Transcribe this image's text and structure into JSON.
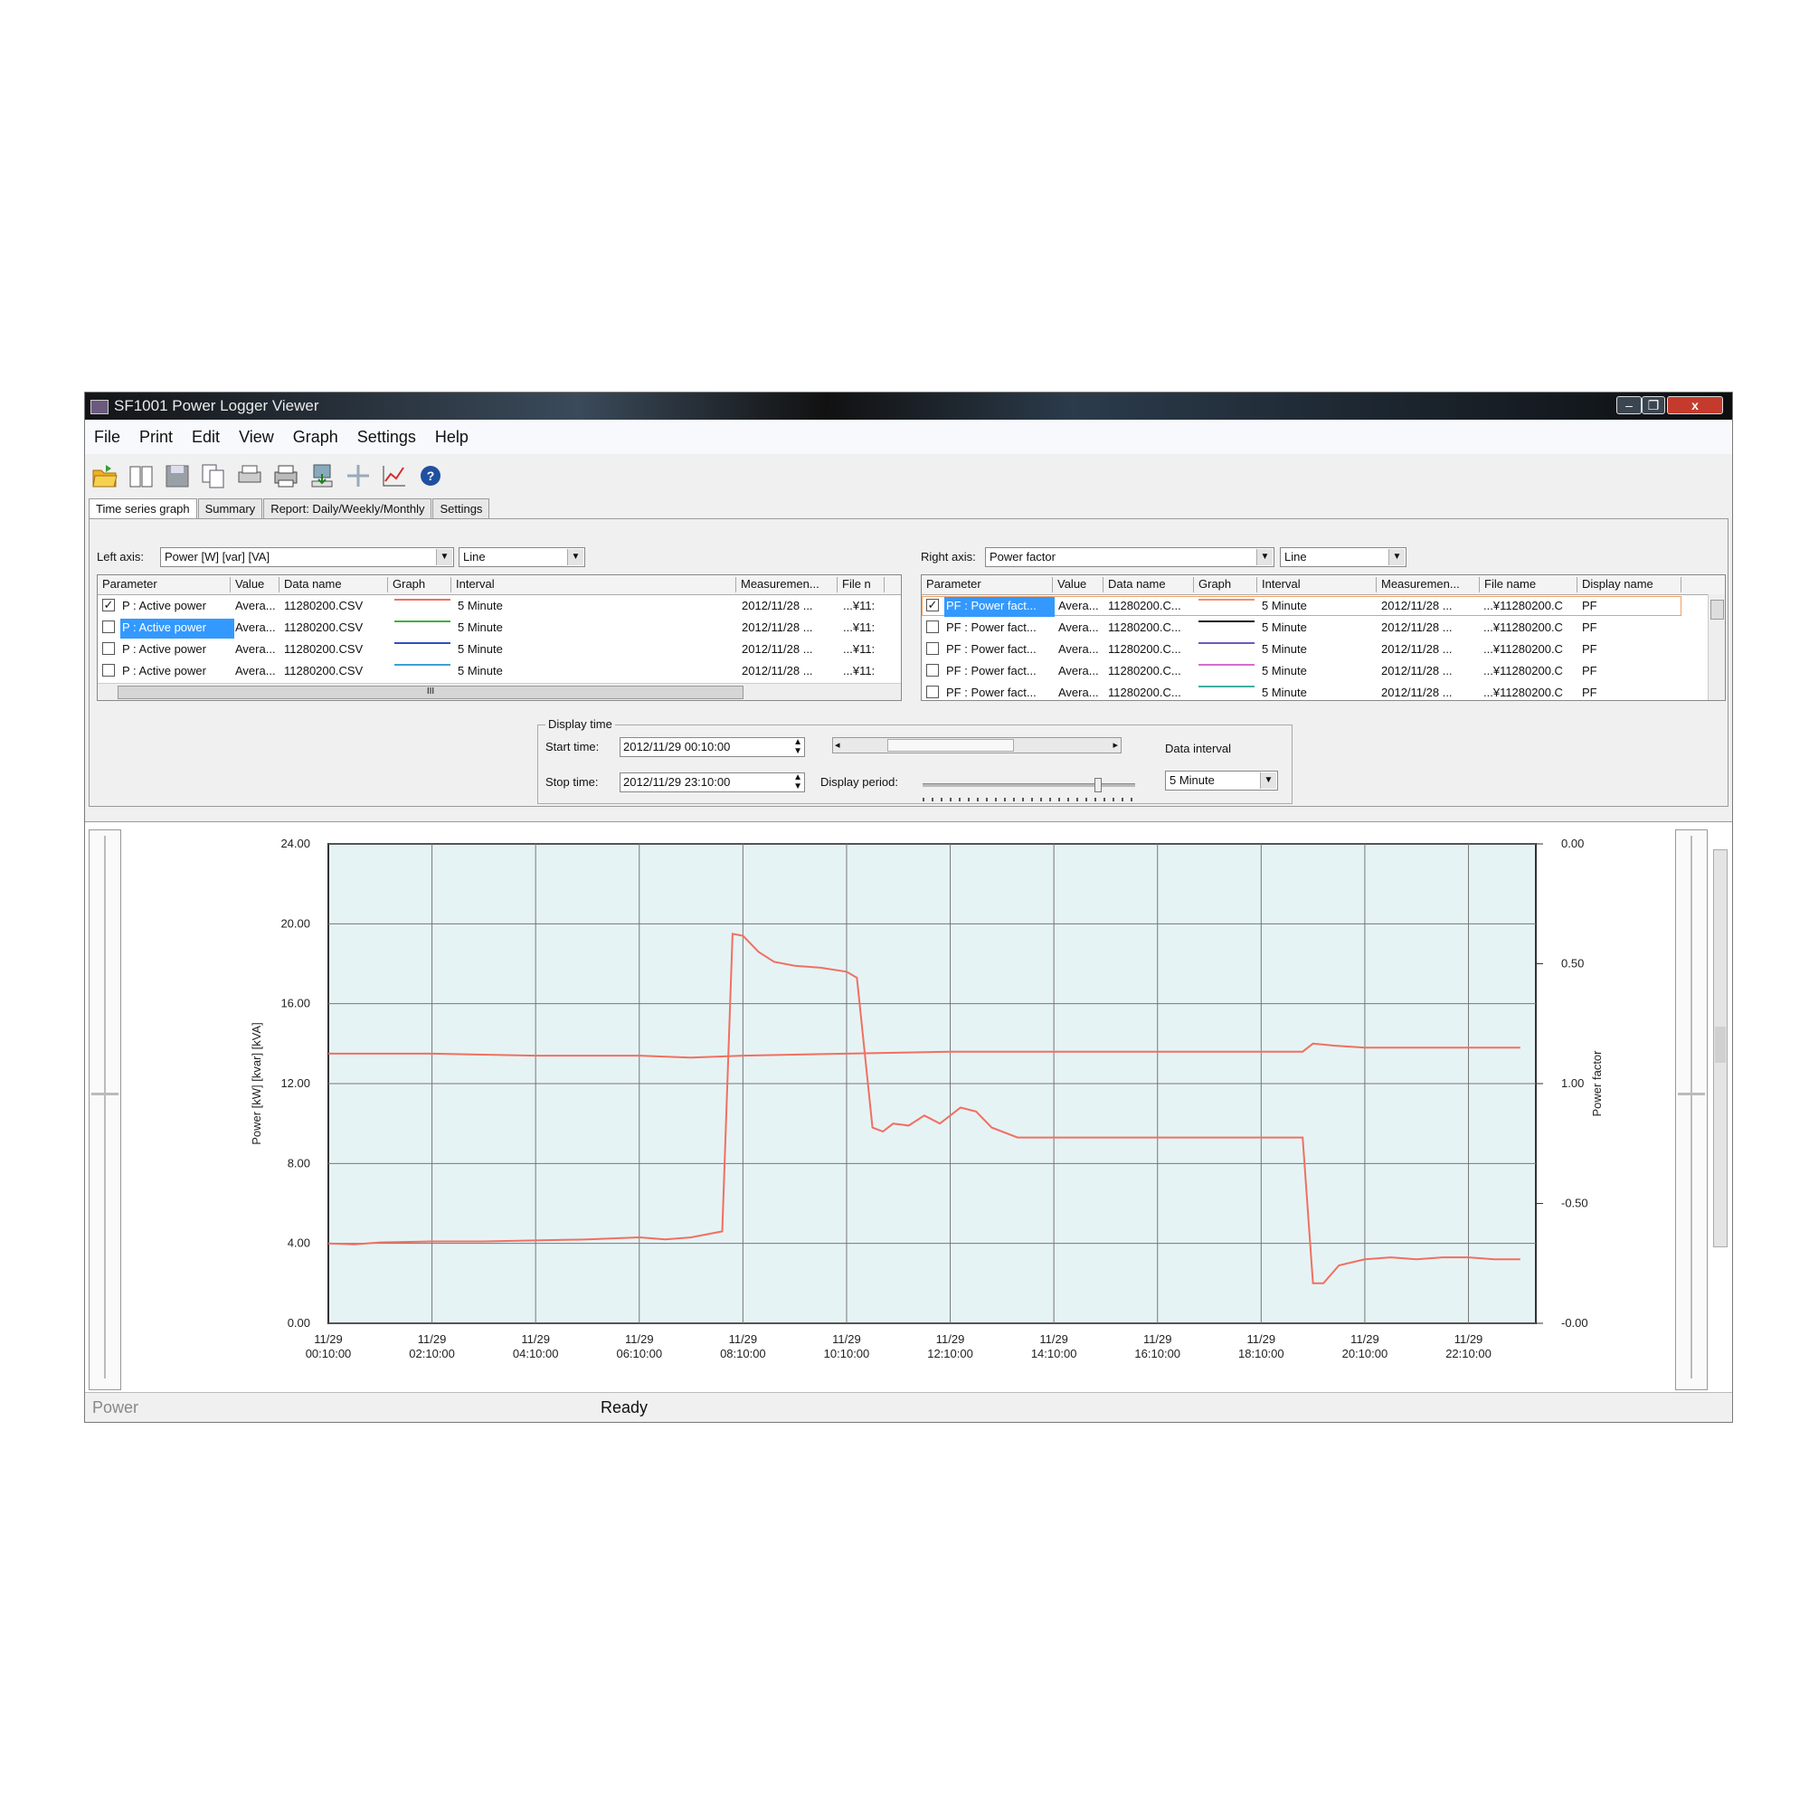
{
  "window": {
    "title": "SF1001 Power Logger Viewer",
    "controls": {
      "minimize": "–",
      "restore": "❐",
      "close": "x"
    }
  },
  "menu": [
    "File",
    "Print",
    "Edit",
    "View",
    "Graph",
    "Settings",
    "Help"
  ],
  "toolbar_icons": [
    "open-folder-icon",
    "book-icon",
    "save-icon",
    "copy-icon",
    "print-preview-icon",
    "printer-icon",
    "export-icon",
    "move-cursor-icon",
    "graph-settings-icon",
    "help-icon"
  ],
  "tabs": [
    "Time series graph",
    "Summary",
    "Report: Daily/Weekly/Monthly",
    "Settings"
  ],
  "left_axis": {
    "label": "Left axis:",
    "parameter": "Power [W] [var] [VA]",
    "style": "Line",
    "columns": [
      "Parameter",
      "Value",
      "Data name",
      "Graph",
      "Interval",
      "Measuremen...",
      "File n"
    ],
    "rows": [
      {
        "checked": true,
        "selected": false,
        "parameter": "P : Active power",
        "value": "Avera...",
        "data_name": "11280200.CSV",
        "color": "#f07060",
        "interval": "5 Minute",
        "measurement": "2012/11/28 ...",
        "file": "...¥11:"
      },
      {
        "checked": false,
        "selected": true,
        "parameter": "P : Active power",
        "value": "Avera...",
        "data_name": "11280200.CSV",
        "color": "#40b040",
        "interval": "5 Minute",
        "measurement": "2012/11/28 ...",
        "file": "...¥11:"
      },
      {
        "checked": false,
        "selected": false,
        "parameter": "P : Active power",
        "value": "Avera...",
        "data_name": "11280200.CSV",
        "color": "#3050c0",
        "interval": "5 Minute",
        "measurement": "2012/11/28 ...",
        "file": "...¥11:"
      },
      {
        "checked": false,
        "selected": false,
        "parameter": "P : Active power",
        "value": "Avera...",
        "data_name": "11280200.CSV",
        "color": "#40a0d0",
        "interval": "5 Minute",
        "measurement": "2012/11/28 ...",
        "file": "...¥11:"
      }
    ],
    "hscroll_grip": "III"
  },
  "right_axis": {
    "label": "Right axis:",
    "parameter": "Power factor",
    "style": "Line",
    "columns": [
      "Parameter",
      "Value",
      "Data name",
      "Graph",
      "Interval",
      "Measuremen...",
      "File name",
      "Display name"
    ],
    "rows": [
      {
        "checked": true,
        "selected": true,
        "parameter": "PF : Power fact...",
        "value": "Avera...",
        "data_name": "11280200.C...",
        "color": "#f09070",
        "interval": "5 Minute",
        "measurement": "2012/11/28 ...",
        "file": "...¥11280200.C",
        "display": "PF"
      },
      {
        "checked": false,
        "selected": false,
        "parameter": "PF : Power fact...",
        "value": "Avera...",
        "data_name": "11280200.C...",
        "color": "#111111",
        "interval": "5 Minute",
        "measurement": "2012/11/28 ...",
        "file": "...¥11280200.C",
        "display": "PF"
      },
      {
        "checked": false,
        "selected": false,
        "parameter": "PF : Power fact...",
        "value": "Avera...",
        "data_name": "11280200.C...",
        "color": "#6a5ac0",
        "interval": "5 Minute",
        "measurement": "2012/11/28 ...",
        "file": "...¥11280200.C",
        "display": "PF"
      },
      {
        "checked": false,
        "selected": false,
        "parameter": "PF : Power fact...",
        "value": "Avera...",
        "data_name": "11280200.C...",
        "color": "#d070d0",
        "interval": "5 Minute",
        "measurement": "2012/11/28 ...",
        "file": "...¥11280200.C",
        "display": "PF"
      },
      {
        "checked": false,
        "selected": false,
        "parameter": "PF : Power fact...",
        "value": "Avera...",
        "data_name": "11280200.C...",
        "color": "#40b0a0",
        "interval": "5 Minute",
        "measurement": "2012/11/28 ...",
        "file": "...¥11280200.C",
        "display": "PF"
      }
    ]
  },
  "display_time": {
    "group_label": "Display time",
    "start_label": "Start time:",
    "start_value": "2012/11/29  00:10:00",
    "stop_label": "Stop time:",
    "stop_value": "2012/11/29  23:10:00",
    "period_label": "Display period:",
    "interval_label": "Data interval",
    "interval_value": "5 Minute"
  },
  "chart_data": {
    "type": "line",
    "ylabel": "Power [kW] [kvar] [kVA]",
    "y2label": "Power factor",
    "ylim": [
      0,
      24
    ],
    "yticks": [
      "24.00",
      "20.00",
      "16.00",
      "12.00",
      "8.00",
      "4.00",
      "0.00"
    ],
    "y2ticks": [
      "0.00",
      "0.50",
      "1.00",
      "-0.50",
      "-0.00"
    ],
    "xlim": [
      0,
      23.3
    ],
    "xticks": [
      {
        "date": "11/29",
        "time": "00:10:00"
      },
      {
        "date": "11/29",
        "time": "02:10:00"
      },
      {
        "date": "11/29",
        "time": "04:10:00"
      },
      {
        "date": "11/29",
        "time": "06:10:00"
      },
      {
        "date": "11/29",
        "time": "08:10:00"
      },
      {
        "date": "11/29",
        "time": "10:10:00"
      },
      {
        "date": "11/29",
        "time": "12:10:00"
      },
      {
        "date": "11/29",
        "time": "14:10:00"
      },
      {
        "date": "11/29",
        "time": "16:10:00"
      },
      {
        "date": "11/29",
        "time": "18:10:00"
      },
      {
        "date": "11/29",
        "time": "20:10:00"
      },
      {
        "date": "11/29",
        "time": "22:10:00"
      }
    ],
    "series": [
      {
        "color": "#f07060",
        "x": [
          0,
          0.5,
          1,
          2,
          3,
          4,
          5,
          6,
          6.5,
          7,
          7.6,
          7.8,
          8.0,
          8.3,
          8.6,
          9,
          9.5,
          10,
          10.2,
          10.5,
          10.7,
          10.9,
          11.2,
          11.5,
          11.8,
          12.2,
          12.5,
          12.8,
          13.3,
          14,
          15,
          16,
          17,
          18,
          18.8,
          19,
          19.2,
          19.5,
          20,
          20.5,
          21,
          21.5,
          22,
          22.5,
          23
        ],
        "y": [
          4.0,
          3.95,
          4.05,
          4.1,
          4.1,
          4.15,
          4.2,
          4.3,
          4.2,
          4.3,
          4.6,
          19.5,
          19.4,
          18.6,
          18.1,
          17.9,
          17.8,
          17.6,
          17.3,
          9.8,
          9.6,
          10.0,
          9.9,
          10.4,
          10.0,
          10.8,
          10.6,
          9.8,
          9.3,
          9.3,
          9.3,
          9.3,
          9.3,
          9.3,
          9.3,
          2.0,
          2.0,
          2.9,
          3.2,
          3.3,
          3.2,
          3.3,
          3.3,
          3.2,
          3.2
        ]
      },
      {
        "color": "#f07060",
        "x": [
          0,
          2,
          4,
          6,
          7,
          8,
          10,
          12,
          14,
          16,
          18,
          18.8,
          19.0,
          19.4,
          20,
          21,
          22,
          23
        ],
        "y": [
          13.5,
          13.5,
          13.4,
          13.4,
          13.3,
          13.4,
          13.5,
          13.6,
          13.6,
          13.6,
          13.6,
          13.6,
          14.0,
          13.9,
          13.8,
          13.8,
          13.8,
          13.8
        ]
      }
    ]
  },
  "status": {
    "left": "Power",
    "middle": "Ready"
  }
}
